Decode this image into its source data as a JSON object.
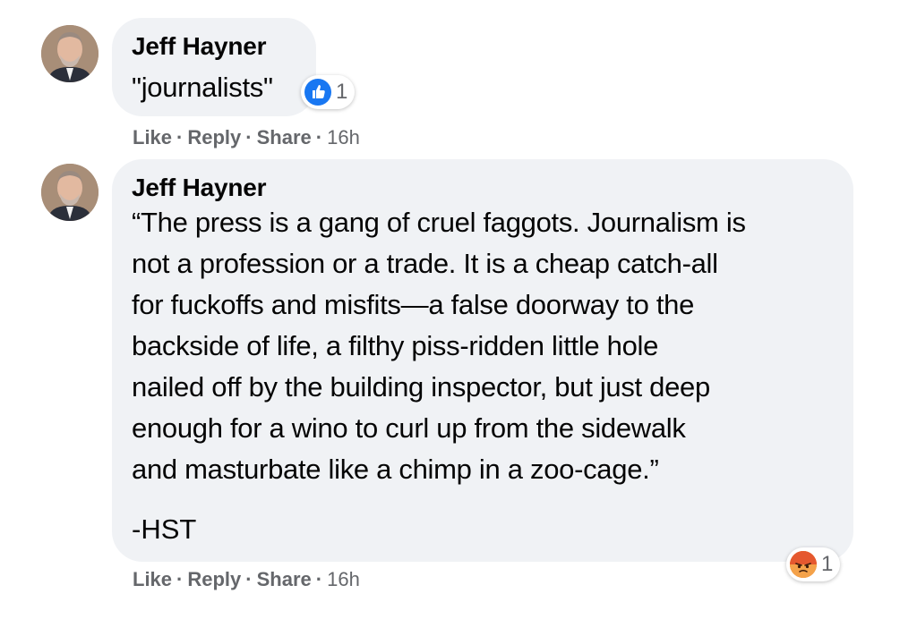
{
  "comments": [
    {
      "author": "Jeff Hayner",
      "text": "\"journalists\"",
      "reaction": {
        "type": "like",
        "count": "1",
        "color": "#1877f2"
      },
      "actions": {
        "like": "Like",
        "reply": "Reply",
        "share": "Share",
        "time": "16h",
        "separator": "·"
      }
    },
    {
      "author": "Jeff Hayner",
      "lines": [
        "“The press is a gang of cruel faggots. Journalism is",
        "not a profession or a trade. It is a cheap catch-all",
        "for fuckoffs and misfits—a false doorway to the",
        "backside of life, a filthy piss-ridden little hole",
        "nailed off by the building inspector, but just deep",
        "enough for a wino to curl up from the sidewalk",
        "and masturbate like a chimp in a zoo-cage.”"
      ],
      "signature": "-HST",
      "reaction": {
        "type": "angry",
        "count": "1",
        "color": "#e9710f"
      },
      "actions": {
        "like": "Like",
        "reply": "Reply",
        "share": "Share",
        "time": "16h",
        "separator": "·"
      }
    }
  ],
  "colors": {
    "bubble": "#f0f2f5",
    "secondary_text": "#65676b",
    "like_blue": "#1877f2"
  }
}
